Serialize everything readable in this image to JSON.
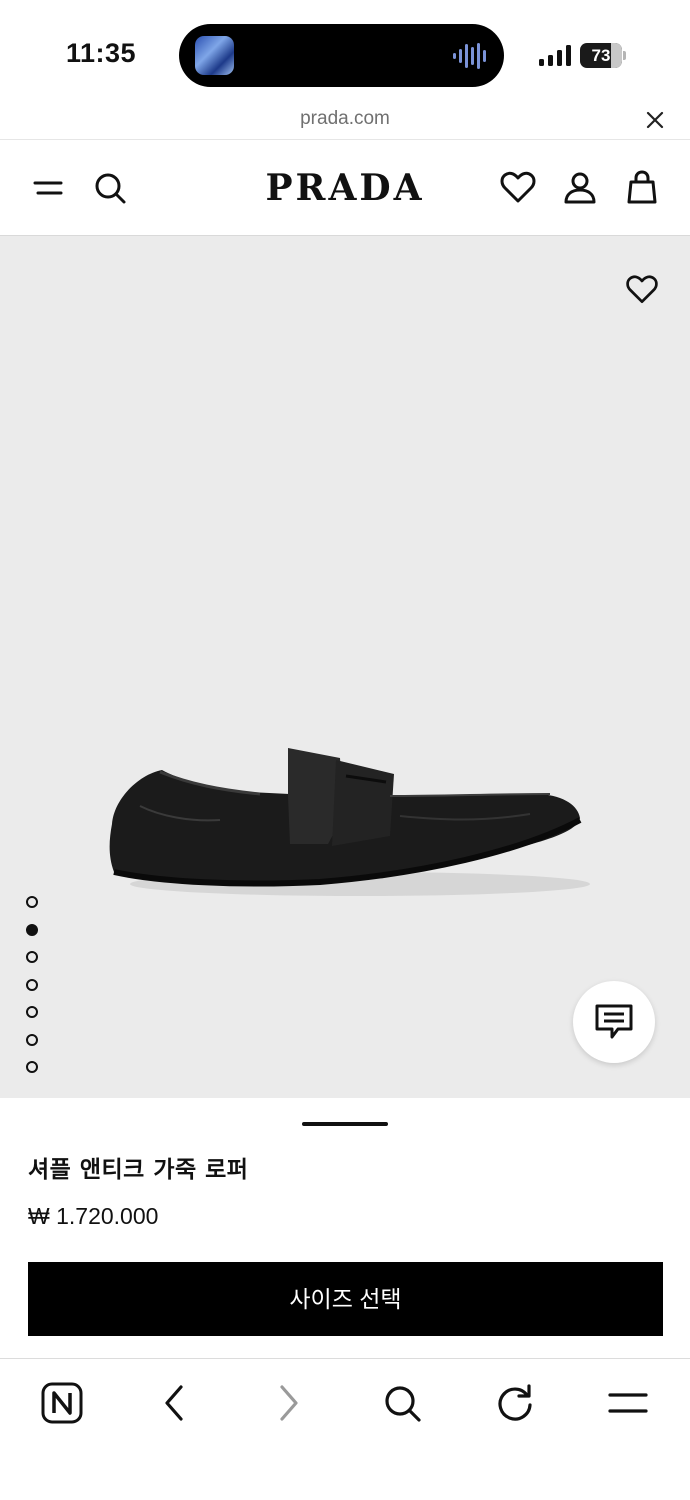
{
  "status_bar": {
    "time": "11:35",
    "battery": "73",
    "battery_level_percent": 73
  },
  "browser": {
    "url": "prada.com"
  },
  "header": {
    "brand": "PRADA"
  },
  "gallery": {
    "image_count": 7,
    "active_index": 1
  },
  "product": {
    "name": "셔플 앤티크 가죽 로퍼",
    "price": "₩ 1.720.000",
    "select_size_label": "사이즈 선택"
  },
  "icons": {
    "menu": "menu-icon",
    "search": "search-icon",
    "wishlist": "heart-icon",
    "account": "user-icon",
    "bag": "bag-icon",
    "chat": "chat-icon",
    "close": "close-icon",
    "home": "naver-icon",
    "back": "chevron-left-icon",
    "forward": "chevron-right-icon",
    "reload": "reload-icon",
    "more": "hamburger-icon"
  }
}
